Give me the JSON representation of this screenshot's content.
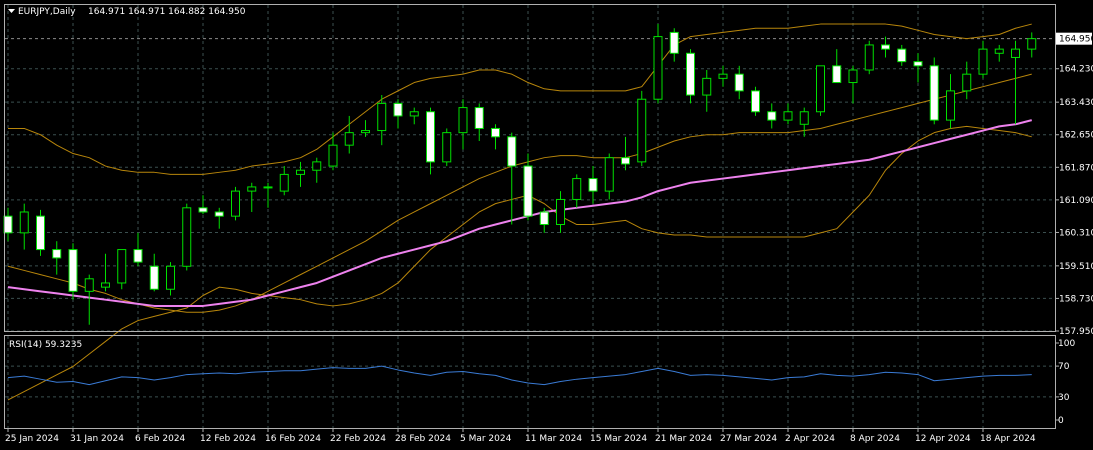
{
  "chart_data": [
    {
      "type": "candlestick",
      "symbol_header": "EURJPY,Daily",
      "ohlc_header": "164.971 164.971 164.882 164.950",
      "current_price": "164.950",
      "ylim": [
        157.95,
        165.05
      ],
      "y_ticks": [
        "164.950",
        "164.230",
        "163.430",
        "162.650",
        "161.870",
        "161.090",
        "160.310",
        "159.510",
        "158.730",
        "157.950"
      ],
      "x_tick_labels": [
        "25 Jan 2024",
        "31 Jan 2024",
        "6 Feb 2024",
        "12 Feb 2024",
        "16 Feb 2024",
        "22 Feb 2024",
        "28 Feb 2024",
        "5 Mar 2024",
        "11 Mar 2024",
        "15 Mar 2024",
        "21 Mar 2024",
        "27 Mar 2024",
        "2 Apr 2024",
        "8 Apr 2024",
        "12 Apr 2024",
        "18 Apr 2024"
      ],
      "grid": true,
      "colors": {
        "background": "#000000",
        "grid": "#3b4f4f",
        "candle_up": "#000000",
        "candle_down": "#ffffff",
        "wick": "#00e000",
        "bands": "#b8860b",
        "ma": "#ee82ee",
        "rsi": "#3a7bd5",
        "axis_text": "#ffffff"
      },
      "ohlc": [
        [
          160.7,
          160.9,
          160.1,
          160.3
        ],
        [
          160.3,
          161.0,
          159.9,
          160.8
        ],
        [
          160.7,
          160.85,
          159.75,
          159.9
        ],
        [
          159.9,
          160.1,
          159.3,
          159.7
        ],
        [
          159.9,
          160.05,
          158.7,
          158.9
        ],
        [
          158.9,
          159.3,
          158.1,
          159.2
        ],
        [
          159.0,
          159.8,
          158.9,
          159.1
        ],
        [
          159.1,
          159.9,
          158.95,
          159.9
        ],
        [
          159.9,
          160.3,
          159.5,
          159.6
        ],
        [
          159.5,
          159.8,
          158.9,
          158.95
        ],
        [
          158.95,
          159.6,
          158.8,
          159.5
        ],
        [
          159.5,
          161.0,
          159.4,
          160.9
        ],
        [
          160.9,
          161.2,
          160.75,
          160.8
        ],
        [
          160.8,
          160.9,
          160.4,
          160.7
        ],
        [
          160.7,
          161.4,
          160.6,
          161.3
        ],
        [
          161.3,
          161.5,
          160.8,
          161.4
        ],
        [
          161.4,
          161.5,
          160.9,
          161.4
        ],
        [
          161.3,
          161.9,
          161.2,
          161.7
        ],
        [
          161.7,
          162.0,
          161.4,
          161.8
        ],
        [
          161.8,
          162.1,
          161.5,
          162.0
        ],
        [
          161.9,
          162.7,
          161.8,
          162.4
        ],
        [
          162.4,
          163.1,
          162.2,
          162.7
        ],
        [
          162.7,
          163.0,
          162.6,
          162.75
        ],
        [
          162.75,
          163.6,
          162.4,
          163.4
        ],
        [
          163.4,
          163.5,
          162.8,
          163.1
        ],
        [
          163.1,
          163.3,
          162.9,
          163.2
        ],
        [
          163.2,
          163.3,
          161.7,
          162.0
        ],
        [
          162.0,
          162.8,
          161.9,
          162.7
        ],
        [
          162.7,
          163.5,
          162.3,
          163.3
        ],
        [
          163.3,
          163.4,
          162.5,
          162.8
        ],
        [
          162.8,
          162.9,
          162.3,
          162.6
        ],
        [
          162.6,
          162.7,
          160.5,
          161.9
        ],
        [
          161.9,
          162.2,
          160.6,
          160.7
        ],
        [
          160.8,
          160.9,
          160.3,
          160.5
        ],
        [
          160.5,
          161.3,
          160.3,
          161.1
        ],
        [
          161.1,
          161.7,
          160.9,
          161.6
        ],
        [
          161.6,
          161.9,
          161.0,
          161.3
        ],
        [
          161.3,
          162.2,
          161.1,
          162.1
        ],
        [
          162.1,
          162.6,
          161.8,
          161.95
        ],
        [
          162.0,
          163.7,
          161.9,
          163.5
        ],
        [
          163.5,
          165.3,
          163.4,
          165.0
        ],
        [
          165.1,
          165.2,
          164.4,
          164.6
        ],
        [
          164.6,
          164.7,
          163.4,
          163.6
        ],
        [
          163.6,
          164.2,
          163.2,
          164.0
        ],
        [
          164.0,
          164.3,
          163.8,
          164.1
        ],
        [
          164.1,
          164.3,
          163.5,
          163.7
        ],
        [
          163.7,
          163.8,
          163.1,
          163.2
        ],
        [
          163.2,
          163.4,
          162.8,
          163.0
        ],
        [
          163.0,
          163.4,
          162.9,
          163.2
        ],
        [
          162.9,
          163.3,
          162.6,
          163.2
        ],
        [
          163.2,
          164.3,
          163.1,
          164.3
        ],
        [
          164.3,
          164.7,
          163.9,
          163.9
        ],
        [
          163.9,
          164.3,
          163.4,
          164.2
        ],
        [
          164.2,
          164.9,
          164.1,
          164.8
        ],
        [
          164.8,
          165.0,
          164.5,
          164.7
        ],
        [
          164.7,
          164.8,
          164.3,
          164.4
        ],
        [
          164.4,
          164.6,
          163.9,
          164.3
        ],
        [
          164.3,
          164.5,
          162.9,
          163.0
        ],
        [
          163.0,
          164.1,
          162.8,
          163.7
        ],
        [
          163.7,
          164.4,
          163.5,
          164.1
        ],
        [
          164.1,
          164.9,
          164.0,
          164.7
        ],
        [
          164.6,
          164.8,
          164.4,
          164.7
        ],
        [
          164.5,
          164.9,
          162.9,
          164.7
        ],
        [
          164.7,
          165.1,
          164.5,
          164.95
        ]
      ],
      "upper_band": [
        162.8,
        162.8,
        162.65,
        162.4,
        162.2,
        162.1,
        161.9,
        161.8,
        161.75,
        161.75,
        161.7,
        161.7,
        161.7,
        161.75,
        161.8,
        161.9,
        161.95,
        162.0,
        162.1,
        162.3,
        162.6,
        162.9,
        163.2,
        163.5,
        163.7,
        163.9,
        164.0,
        164.05,
        164.1,
        164.2,
        164.2,
        164.1,
        163.9,
        163.75,
        163.7,
        163.7,
        163.7,
        163.7,
        163.7,
        163.8,
        164.3,
        164.8,
        165.0,
        165.05,
        165.1,
        165.15,
        165.2,
        165.2,
        165.2,
        165.25,
        165.3,
        165.3,
        165.3,
        165.3,
        165.3,
        165.25,
        165.15,
        165.05,
        165.0,
        164.95,
        165.0,
        165.05,
        165.2,
        165.3
      ],
      "middle_band": [
        159.5,
        159.4,
        159.3,
        159.2,
        159.1,
        158.95,
        158.85,
        158.7,
        158.6,
        158.5,
        158.45,
        158.4,
        158.4,
        158.45,
        158.55,
        158.7,
        158.9,
        159.1,
        159.3,
        159.5,
        159.7,
        159.9,
        160.1,
        160.35,
        160.6,
        160.8,
        161.0,
        161.2,
        161.4,
        161.6,
        161.75,
        161.9,
        162.0,
        162.1,
        162.15,
        162.15,
        162.1,
        162.1,
        162.1,
        162.2,
        162.35,
        162.5,
        162.6,
        162.65,
        162.65,
        162.7,
        162.7,
        162.7,
        162.7,
        162.75,
        162.8,
        162.9,
        163.0,
        163.1,
        163.2,
        163.3,
        163.4,
        163.5,
        163.6,
        163.7,
        163.8,
        163.9,
        164.0,
        164.1
      ],
      "lower_band": [
        156.3,
        156.5,
        156.7,
        156.9,
        157.1,
        157.4,
        157.7,
        158.0,
        158.2,
        158.3,
        158.4,
        158.5,
        158.8,
        159.0,
        158.95,
        158.85,
        158.8,
        158.75,
        158.7,
        158.6,
        158.55,
        158.6,
        158.7,
        158.85,
        159.1,
        159.5,
        159.9,
        160.2,
        160.5,
        160.8,
        161.0,
        161.1,
        161.2,
        161.0,
        160.7,
        160.5,
        160.5,
        160.55,
        160.6,
        160.4,
        160.3,
        160.25,
        160.25,
        160.2,
        160.2,
        160.2,
        160.2,
        160.2,
        160.2,
        160.2,
        160.3,
        160.4,
        160.8,
        161.2,
        161.8,
        162.2,
        162.5,
        162.7,
        162.8,
        162.85,
        162.8,
        162.75,
        162.7,
        162.6
      ],
      "ma": [
        159.0,
        158.95,
        158.9,
        158.85,
        158.8,
        158.75,
        158.7,
        158.65,
        158.6,
        158.55,
        158.55,
        158.55,
        158.55,
        158.6,
        158.65,
        158.7,
        158.8,
        158.9,
        159.0,
        159.1,
        159.25,
        159.4,
        159.55,
        159.7,
        159.8,
        159.9,
        160.0,
        160.1,
        160.25,
        160.4,
        160.5,
        160.6,
        160.7,
        160.8,
        160.85,
        160.9,
        160.95,
        161.0,
        161.05,
        161.15,
        161.3,
        161.4,
        161.5,
        161.55,
        161.6,
        161.65,
        161.7,
        161.75,
        161.8,
        161.85,
        161.9,
        161.95,
        162.0,
        162.05,
        162.15,
        162.25,
        162.35,
        162.45,
        162.55,
        162.65,
        162.75,
        162.85,
        162.9,
        163.0
      ],
      "rsi_label": "RSI(14) 59.3235",
      "rsi_ylim": [
        0,
        100
      ],
      "rsi_ticks": [
        "100",
        "70",
        "30",
        "0"
      ],
      "rsi": [
        55,
        57,
        53,
        49,
        50,
        46,
        51,
        56,
        55,
        52,
        55,
        59,
        60,
        61,
        60,
        62,
        63,
        64,
        64,
        66,
        68,
        67,
        67,
        70,
        65,
        61,
        58,
        62,
        63,
        60,
        58,
        52,
        48,
        46,
        50,
        53,
        55,
        57,
        59,
        63,
        67,
        63,
        58,
        59,
        58,
        56,
        54,
        52,
        55,
        56,
        60,
        58,
        57,
        59,
        62,
        61,
        59,
        51,
        53,
        55,
        57,
        58,
        58,
        59
      ]
    }
  ]
}
